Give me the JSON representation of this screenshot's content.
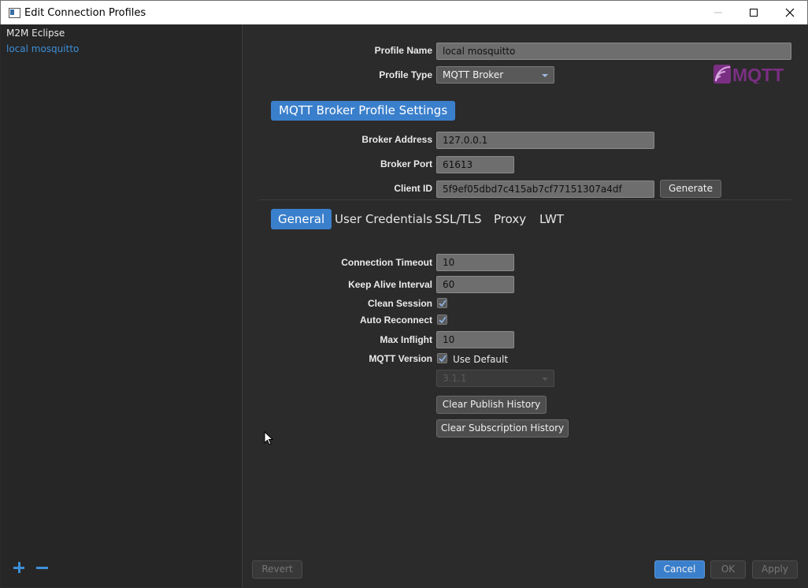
{
  "window": {
    "title": "Edit Connection Profiles"
  },
  "sidebar": {
    "items": [
      {
        "label": "M2M Eclipse"
      },
      {
        "label": "local mosquitto"
      }
    ]
  },
  "profile": {
    "name_label": "Profile Name",
    "name_value": "local mosquitto",
    "type_label": "Profile Type",
    "type_value": "MQTT Broker",
    "logo_text": "MQTT"
  },
  "broker": {
    "section_title": "MQTT Broker Profile Settings",
    "address_label": "Broker Address",
    "address_value": "127.0.0.1",
    "port_label": "Broker Port",
    "port_value": "61613",
    "client_id_label": "Client ID",
    "client_id_value": "5f9ef05dbd7c415ab7cf77151307a4df",
    "generate_label": "Generate"
  },
  "tabs": [
    {
      "label": "General"
    },
    {
      "label": "User Credentials"
    },
    {
      "label": "SSL/TLS"
    },
    {
      "label": "Proxy"
    },
    {
      "label": "LWT"
    }
  ],
  "general": {
    "timeout_label": "Connection Timeout",
    "timeout_value": "10",
    "keepalive_label": "Keep Alive Interval",
    "keepalive_value": "60",
    "clean_session_label": "Clean Session",
    "clean_session_checked": true,
    "auto_reconnect_label": "Auto Reconnect",
    "auto_reconnect_checked": true,
    "max_inflight_label": "Max Inflight",
    "max_inflight_value": "10",
    "mqtt_version_label": "MQTT Version",
    "use_default_label": "Use Default",
    "use_default_checked": true,
    "version_value": "3.1.1",
    "clear_publish_label": "Clear Publish History",
    "clear_subscription_label": "Clear Subscription History"
  },
  "footer": {
    "revert_label": "Revert",
    "cancel_label": "Cancel",
    "ok_label": "OK",
    "apply_label": "Apply"
  },
  "colors": {
    "accent": "#3a7fcb",
    "selected_text": "#3d8fd8",
    "background": "#2b2b2b",
    "sidebar": "#262626"
  }
}
